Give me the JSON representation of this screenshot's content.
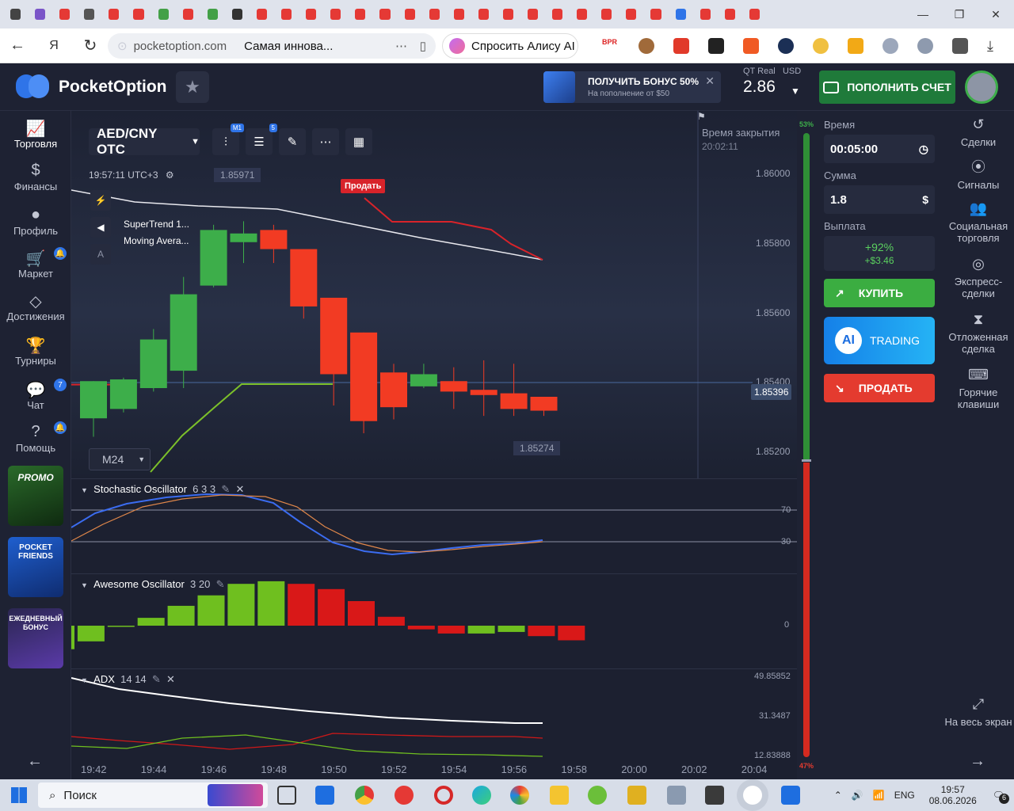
{
  "browser": {
    "url_domain": "pocketoption.com",
    "page_title": "Самая иннова...",
    "alice_label": "Спросить Алису AI",
    "ext_badge": "BPR"
  },
  "header": {
    "logo": "PocketOption",
    "bonus_title": "ПОЛУЧИТЬ БОНУС 50%",
    "bonus_sub": "На пополнение от $50",
    "account_type": "QT Real",
    "account_currency": "USD",
    "balance": "2.86",
    "deposit_label": "ПОПОЛНИТЬ СЧЕТ"
  },
  "leftnav": [
    {
      "label": "Торговля",
      "icon": "chart-icon"
    },
    {
      "label": "Финансы",
      "icon": "dollar-icon"
    },
    {
      "label": "Профиль",
      "icon": "user-icon"
    },
    {
      "label": "Маркет",
      "icon": "cart-icon"
    },
    {
      "label": "Достижения",
      "icon": "diamond-icon"
    },
    {
      "label": "Турниры",
      "icon": "trophy-icon"
    },
    {
      "label": "Чат",
      "icon": "chat-icon",
      "badge": "7"
    },
    {
      "label": "Помощь",
      "icon": "help-icon"
    }
  ],
  "promos": {
    "promo": "PROMO",
    "friends": "POCKET FRIENDS",
    "daily": "ЕЖЕДНЕВНЫЙ БОНУС"
  },
  "chart": {
    "pair": "AED/CNY OTC",
    "timeframe_badge": "M1",
    "indicators_badge": "5",
    "time_label": "19:57:11 UTC+3",
    "high_marker": "1.85971",
    "low_marker": "1.85274",
    "sell_tag": "Продать",
    "indicator1": "SuperTrend 1...",
    "indicator2": "Moving Avera...",
    "close_label": "Время закрытия",
    "close_time": "20:02:11",
    "current_price": "1.85396",
    "expiry_select": "M24",
    "price_ticks": [
      "1.86000",
      "1.85800",
      "1.85600",
      "1.85400",
      "1.85200"
    ],
    "time_ticks": [
      "19:42",
      "19:44",
      "19:46",
      "19:48",
      "19:50",
      "19:52",
      "19:54",
      "19:56",
      "19:58",
      "20:00",
      "20:02",
      "20:04"
    ],
    "stoch_title": "Stochastic Oscillator",
    "stoch_params": "6 3 3",
    "stoch_levels": [
      "70",
      "30"
    ],
    "ao_title": "Awesome Oscillator",
    "ao_params": "3 20",
    "ao_zero": "0",
    "adx_title": "ADX",
    "adx_params": "14 14",
    "adx_ticks": [
      "49.85852",
      "31.3487",
      "12.83888"
    ],
    "buy_pct": "53%",
    "sell_pct": "47%"
  },
  "trade": {
    "time_label": "Время",
    "time_value": "00:05:00",
    "amount_label": "Сумма",
    "amount_value": "1.8",
    "payout_label": "Выплата",
    "payout_pct": "+92%",
    "payout_amt": "+$3.46",
    "buy": "КУПИТЬ",
    "ai_label": "TRADING",
    "ai_badge": "AI",
    "sell": "ПРОДАТЬ"
  },
  "rightnav": [
    {
      "label": "Сделки",
      "icon": "history-icon"
    },
    {
      "label": "Сигналы",
      "icon": "signal-icon"
    },
    {
      "label": "Социальная торговля",
      "icon": "social-icon"
    },
    {
      "label": "Экспресс-сделки",
      "icon": "target-icon"
    },
    {
      "label": "Отложенная сделка",
      "icon": "hourglass-icon"
    },
    {
      "label": "Горячие клавиши",
      "icon": "keyboard-icon"
    },
    {
      "label": "На весь экран",
      "icon": "fullscreen-icon"
    }
  ],
  "taskbar": {
    "search": "Поиск",
    "lang": "ENG",
    "time": "19:57",
    "date": "08.06.2026",
    "notif": "6"
  },
  "candles": [
    {
      "o": 1.85293,
      "h": 1.854,
      "l": 1.8524,
      "c": 1.854
    },
    {
      "o": 1.8532,
      "h": 1.8541,
      "l": 1.8531,
      "c": 1.85405
    },
    {
      "o": 1.8538,
      "h": 1.8555,
      "l": 1.8537,
      "c": 1.8552
    },
    {
      "o": 1.8543,
      "h": 1.857,
      "l": 1.8538,
      "c": 1.8565
    },
    {
      "o": 1.85675,
      "h": 1.8585,
      "l": 1.8567,
      "c": 1.85835
    },
    {
      "o": 1.858,
      "h": 1.8586,
      "l": 1.8574,
      "c": 1.85825
    },
    {
      "o": 1.85835,
      "h": 1.8585,
      "l": 1.8574,
      "c": 1.8578
    },
    {
      "o": 1.8578,
      "h": 1.8578,
      "l": 1.8558,
      "c": 1.85615
    },
    {
      "o": 1.8564,
      "h": 1.8564,
      "l": 1.8533,
      "c": 1.8542
    },
    {
      "o": 1.8554,
      "h": 1.8554,
      "l": 1.8525,
      "c": 1.85285
    },
    {
      "o": 1.85425,
      "h": 1.8545,
      "l": 1.8529,
      "c": 1.85325
    },
    {
      "o": 1.85385,
      "h": 1.8545,
      "l": 1.8538,
      "c": 1.8542
    },
    {
      "o": 1.854,
      "h": 1.8544,
      "l": 1.8532,
      "c": 1.8537
    },
    {
      "o": 1.85375,
      "h": 1.8546,
      "l": 1.853,
      "c": 1.8536
    },
    {
      "o": 1.85365,
      "h": 1.8545,
      "l": 1.853,
      "c": 1.8532
    },
    {
      "o": 1.85355,
      "h": 1.85355,
      "l": 1.853,
      "c": 1.85315
    }
  ],
  "ao_values": [
    -0.45,
    -0.3,
    0.0,
    0.15,
    0.38,
    0.58,
    0.8,
    0.85,
    0.8,
    0.7,
    0.47,
    0.17,
    -0.07,
    -0.15,
    -0.15,
    -0.12,
    -0.2,
    -0.28
  ],
  "colors": {
    "up": "#3dae4a",
    "down": "#f23b23",
    "accent": "#2f74e8"
  }
}
